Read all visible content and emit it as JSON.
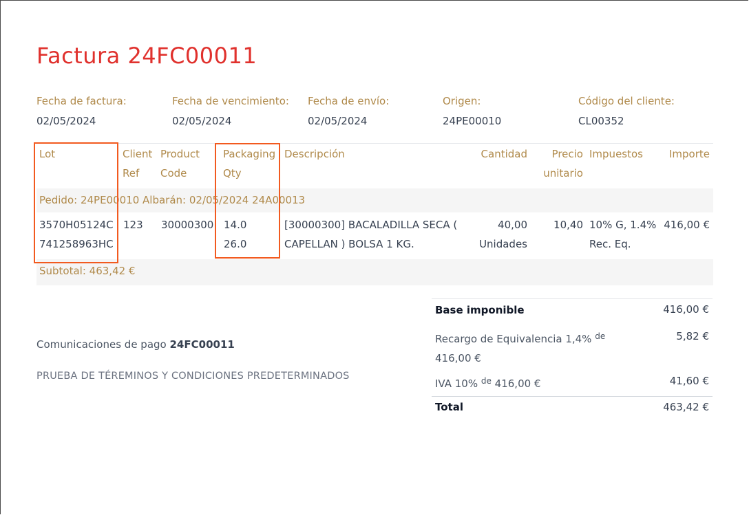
{
  "invoice": {
    "title": "Factura 24FC00011"
  },
  "info": [
    {
      "label": "Fecha de factura:",
      "value": "02/05/2024"
    },
    {
      "label": "Fecha de vencimiento:",
      "value": "02/05/2024"
    },
    {
      "label": "Fecha de envío:",
      "value": "02/05/2024"
    },
    {
      "label": "Origen:",
      "value": "24PE00010"
    },
    {
      "label": "Código del cliente:",
      "value": "CL00352"
    }
  ],
  "table": {
    "headers": {
      "lot": "Lot",
      "client_ref": "Client Ref",
      "product_code": "Product Code",
      "packaging_qty": "Packaging Qty",
      "description": "Descripción",
      "quantity": "Cantidad",
      "unit_price": "Precio unitario",
      "taxes": "Impuestos",
      "amount": "Importe"
    },
    "order_line": "Pedido: 24PE00010 Albarán: 02/05/2024 24A00013",
    "row": {
      "lot_1": "3570H05124C",
      "lot_2": "741258963HC",
      "client_ref": "123",
      "product_code": "30000300",
      "packaging_1": "14.0",
      "packaging_2": "26.0",
      "description": "[30000300] BACALADILLA SECA ( CAPELLAN ) BOLSA 1 KG.",
      "quantity_1": "40,00",
      "quantity_2": "Unidades",
      "unit_price": "10,40",
      "taxes": "10% G, 1.4% Rec. Eq.",
      "amount": "416,00 €"
    },
    "subtotal": "Subtotal: 463,42 €"
  },
  "payment": {
    "prefix": "Comunicaciones de pago ",
    "reference": "24FC00011",
    "terms": "PRUEBA DE TÉREMINOS Y CONDICIONES PREDETERMINADOS"
  },
  "totals": {
    "base_label": "Base imponible",
    "base_value": "416,00 €",
    "recargo_label": "Recargo de Equivalencia 1,4%",
    "recargo_de": "de",
    "recargo_base": "416,00 €",
    "recargo_value": "5,82 €",
    "iva_label": "IVA 10%",
    "iva_de": "de",
    "iva_base": "416,00 €",
    "iva_value": "41,60 €",
    "total_label": "Total",
    "total_value": "463,42 €"
  },
  "colors": {
    "title": "#e0312d",
    "accent": "#b08a4b",
    "highlight": "#f25a1f"
  }
}
